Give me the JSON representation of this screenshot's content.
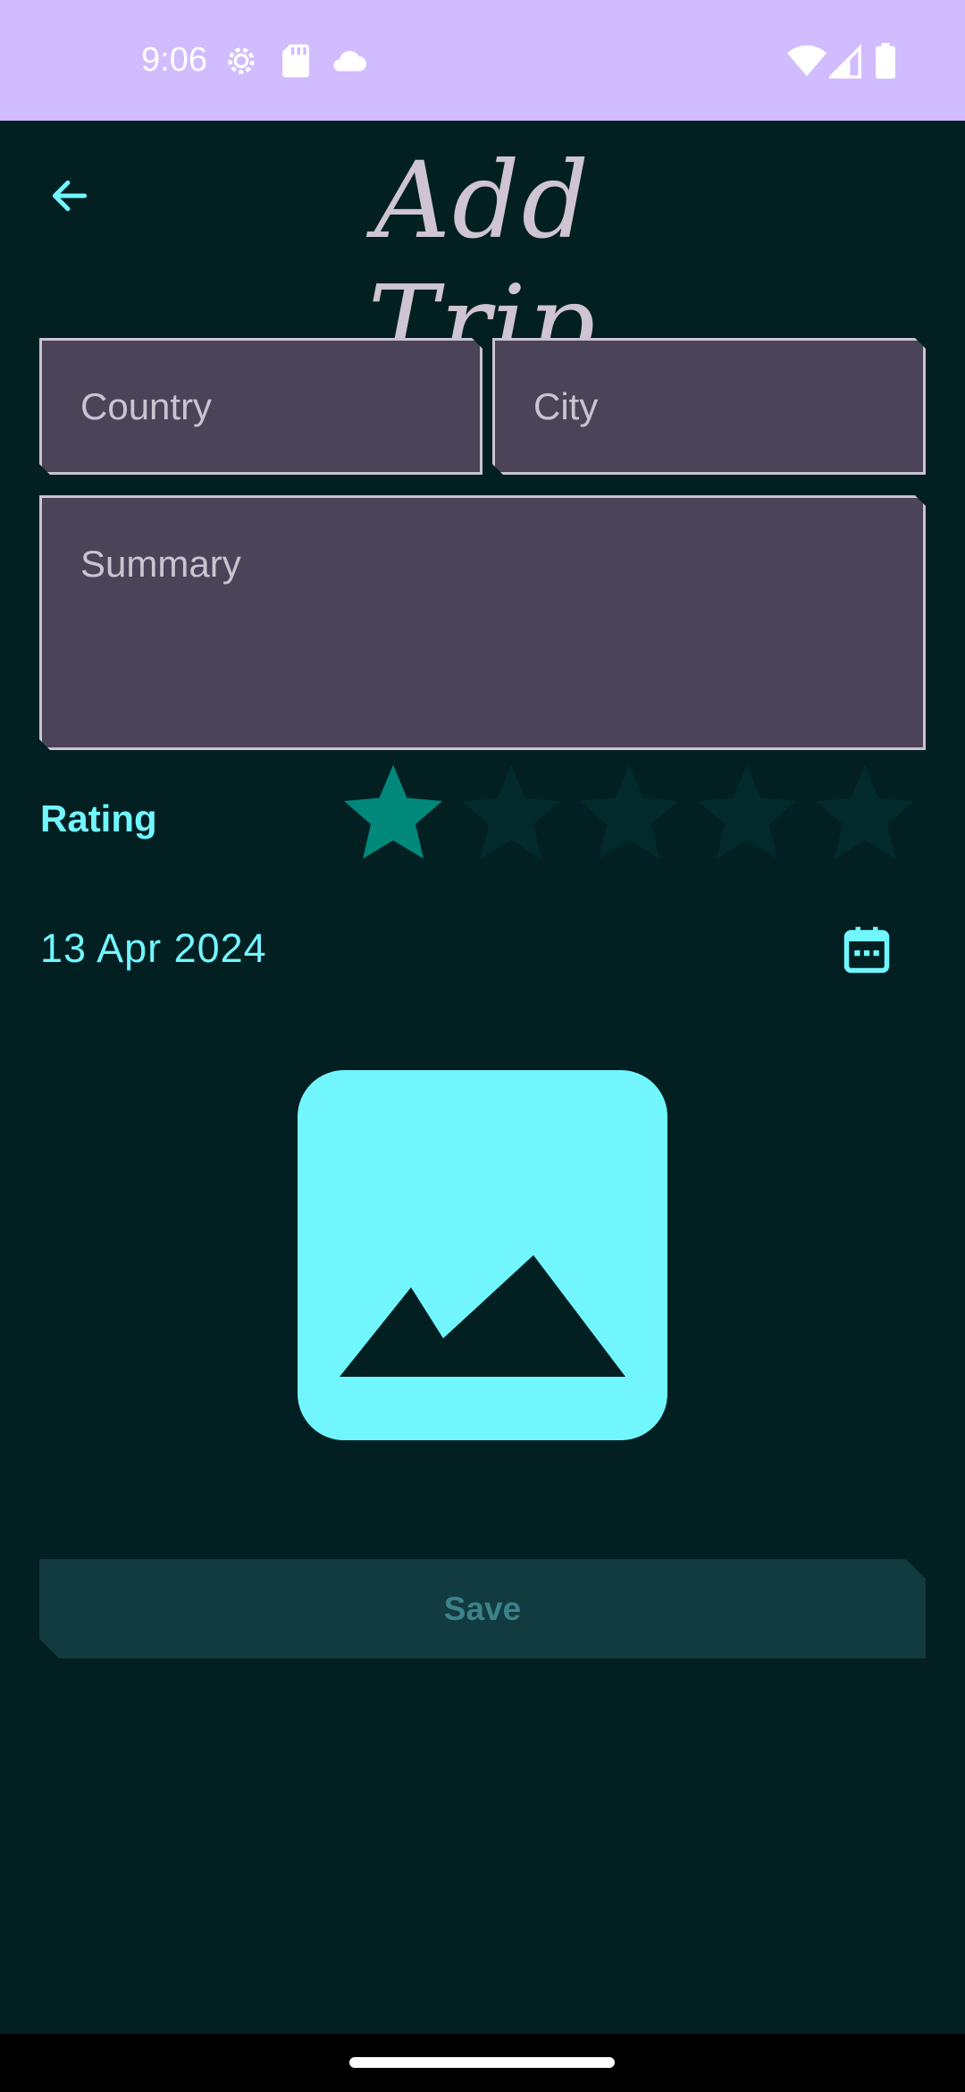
{
  "status_bar": {
    "time": "9:06",
    "icons_left": [
      "settings-gear-icon",
      "sd-card-icon",
      "cloud-icon"
    ],
    "icons_right": [
      "wifi-icon",
      "cellular-signal-icon",
      "battery-icon"
    ],
    "background": "#d0bcfe"
  },
  "header": {
    "title": "Add Trip",
    "back_icon": "arrow-left-icon"
  },
  "form": {
    "country": {
      "placeholder": "Country",
      "value": ""
    },
    "city": {
      "placeholder": "City",
      "value": ""
    },
    "summary": {
      "placeholder": "Summary",
      "value": ""
    }
  },
  "rating": {
    "label": "Rating",
    "value": 1,
    "max": 5,
    "filled_color": "#00897b",
    "empty_color": "#022a2c"
  },
  "date": {
    "value": "13 Apr 2024",
    "icon": "calendar-icon"
  },
  "image_picker": {
    "icon": "image-placeholder-icon",
    "background": "#71f6fe"
  },
  "save_button": {
    "label": "Save"
  },
  "colors": {
    "background": "#021f22",
    "accent": "#71f6fe",
    "field_background": "#4b4459",
    "field_text": "#cac4d0",
    "title_color": "#cfc4d1",
    "save_background": "#123b3f",
    "save_text": "#3c8388"
  }
}
